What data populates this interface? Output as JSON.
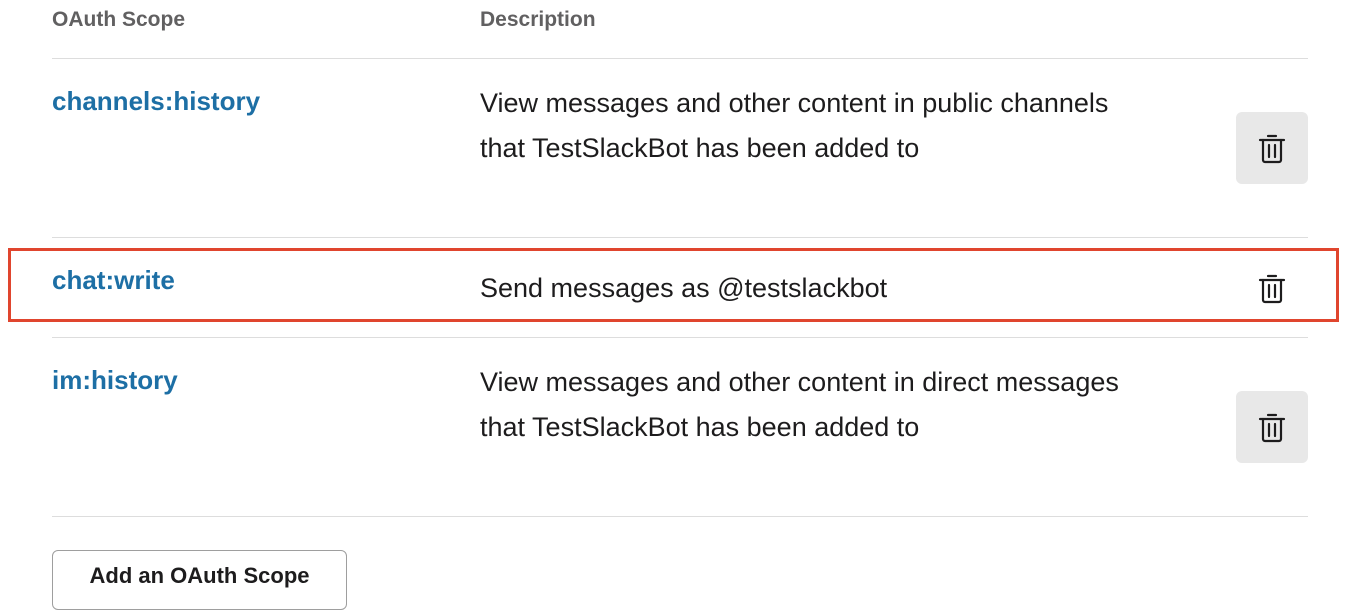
{
  "table": {
    "headers": {
      "scope": "OAuth Scope",
      "description": "Description"
    },
    "rows": [
      {
        "scope": "channels:history",
        "description": "View messages and other content in public channels that TestSlackBot has been added to",
        "delete_icon": "trash-icon"
      },
      {
        "scope": "chat:write",
        "description": "Send messages as @testslackbot",
        "delete_icon": "trash-icon"
      },
      {
        "scope": "im:history",
        "description": "View messages and other content in direct messages that TestSlackBot has been added to",
        "delete_icon": "trash-icon"
      }
    ]
  },
  "add_button": {
    "label": "Add an OAuth Scope"
  },
  "colors": {
    "scope_link": "#1d6fa5",
    "highlight": "#e0452e",
    "button_bg": "#e8e8e8"
  }
}
